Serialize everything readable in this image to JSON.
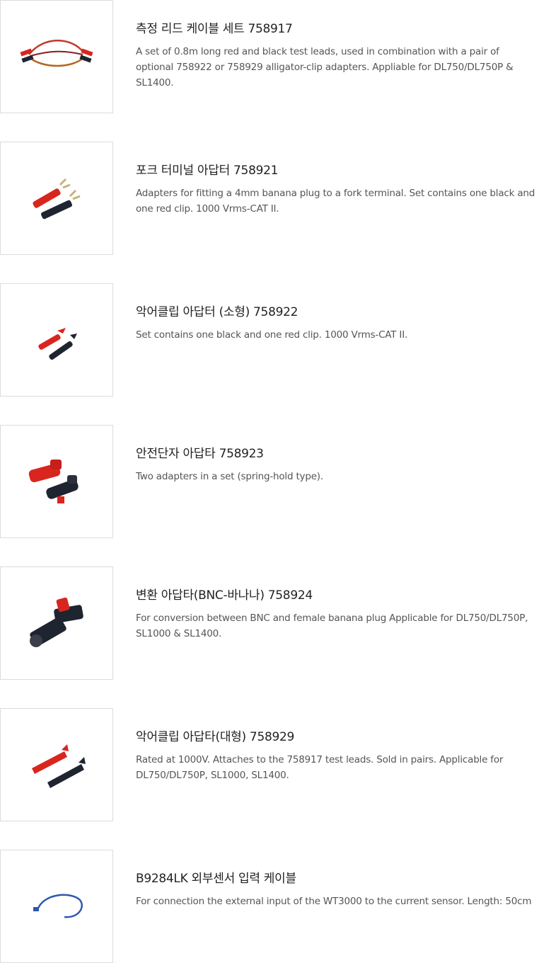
{
  "products": [
    {
      "title": "측정 리드 케이블 세트 758917",
      "desc": "A set of 0.8m long red and black test leads, used in combination with a pair of optional 758922 or 758929 alligator-clip adapters. Appliable for DL750/DL750P & SL1400.",
      "image": "test-lead-cable-set"
    },
    {
      "title": "포크 터미널 아답터 758921",
      "desc": "Adapters for fitting a 4mm banana plug to a fork terminal. Set contains one black and one red clip. 1000 Vrms-CAT II.",
      "image": "fork-terminal-adapter"
    },
    {
      "title": "악어클립 아답터 (소형) 758922",
      "desc": "Set contains one black and one red clip. 1000 Vrms-CAT II.",
      "image": "small-alligator-clip-adapter"
    },
    {
      "title": "안전단자 아답타 758923",
      "desc": "Two adapters in a set (spring-hold type).",
      "image": "safety-terminal-adapter"
    },
    {
      "title": "변환 아답타(BNC-바나나) 758924",
      "desc": "For conversion between BNC and female banana plug Applicable for DL750/DL750P, SL1000 & SL1400.",
      "image": "bnc-banana-adapter"
    },
    {
      "title": "악어클립 아답타(대형) 758929",
      "desc": "Rated at 1000V. Attaches to the 758917 test leads. Sold in pairs. Applicable for DL750/DL750P, SL1000, SL1400.",
      "image": "large-alligator-clip-adapter"
    },
    {
      "title": "B9284LK 외부센서 입력 케이블",
      "desc": "For connection the external input of the WT3000 to the current sensor. Length: 50cm",
      "image": "external-sensor-input-cable"
    }
  ],
  "colors": {
    "red": "#d8261f",
    "black": "#1e2430",
    "blue": "#2f56b0",
    "brass": "#c9b27a"
  }
}
